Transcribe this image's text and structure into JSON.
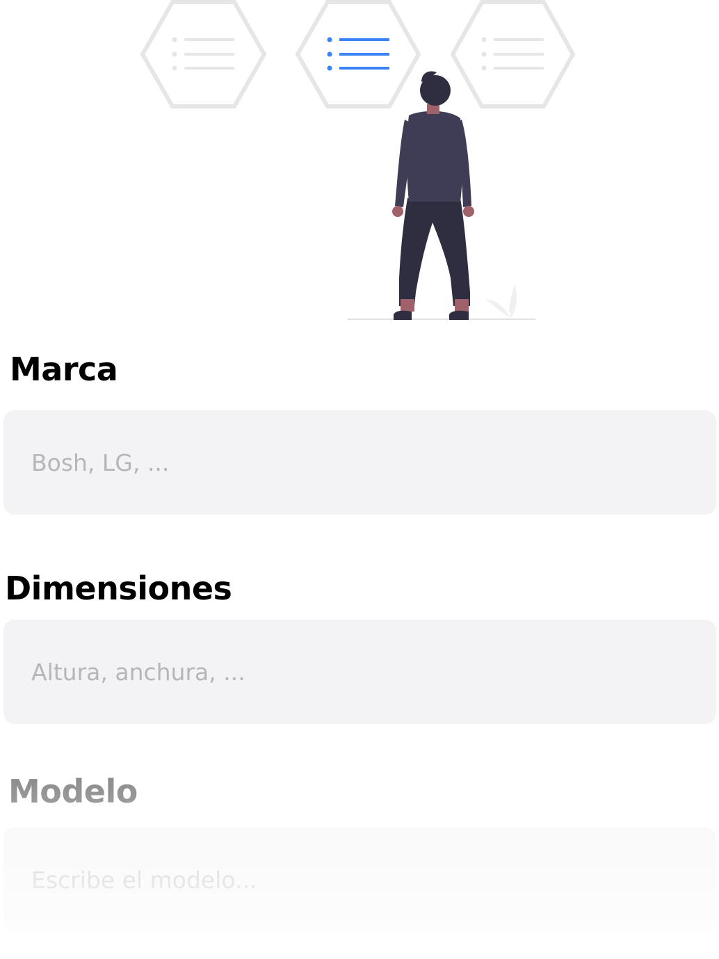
{
  "form": {
    "fields": [
      {
        "label": "Marca",
        "placeholder": "Bosh, LG, ..."
      },
      {
        "label": "Dimensiones",
        "placeholder": "Altura, anchura, ..."
      },
      {
        "label": "Modelo",
        "placeholder": "Escribe el modelo..."
      }
    ]
  },
  "illustration": {
    "icons": [
      "list-icon",
      "list-icon-active",
      "list-icon"
    ],
    "colors": {
      "hexagon": "#e6e6e6",
      "active_list": "#3b82f6",
      "shirt": "#3f3d56",
      "pants": "#2f2e41",
      "skin": "#a0616a"
    }
  }
}
